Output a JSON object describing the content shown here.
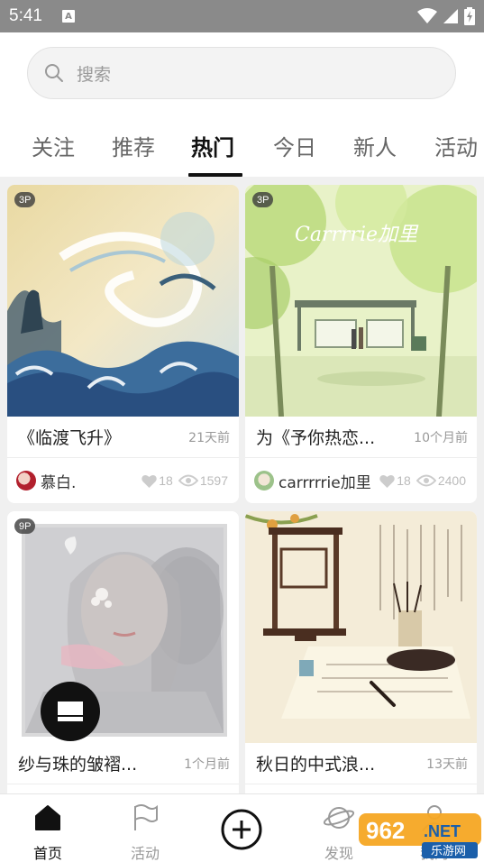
{
  "status_bar": {
    "time": "5:41",
    "a_icon": "A"
  },
  "search": {
    "placeholder": "搜索"
  },
  "tabs": [
    {
      "label": "关注"
    },
    {
      "label": "推荐"
    },
    {
      "label": "热门"
    },
    {
      "label": "今日"
    },
    {
      "label": "新人"
    },
    {
      "label": "活动"
    }
  ],
  "active_tab": "热门",
  "cards": [
    {
      "badge": "3P",
      "title": "《临渡飞升》",
      "time": "21天前",
      "author": "慕白.",
      "likes": "18",
      "views": "1597"
    },
    {
      "badge": "3P",
      "title": "为《予你热恋...",
      "time": "10个月前",
      "author": "carrrrrie加里",
      "likes": "18",
      "views": "2400",
      "image_text": "Carrrrie加里"
    },
    {
      "badge": "9P",
      "title": "纱与珠的皱褶...",
      "time": "1个月前"
    },
    {
      "title": "秋日的中式浪...",
      "time": "13天前"
    }
  ],
  "bottom_nav": [
    {
      "label": "首页",
      "icon": "home-icon"
    },
    {
      "label": "活动",
      "icon": "flag-icon"
    },
    {
      "label": "",
      "icon": "add-circle-icon"
    },
    {
      "label": "发现",
      "icon": "planet-icon"
    },
    {
      "label": "我的",
      "icon": "person-icon"
    }
  ],
  "watermark": {
    "number": "962",
    "suffix": ".NET",
    "sub": "乐游网"
  },
  "colors": {
    "accent": "#111111",
    "muted": "#999999",
    "background": "#f0f0f0"
  }
}
